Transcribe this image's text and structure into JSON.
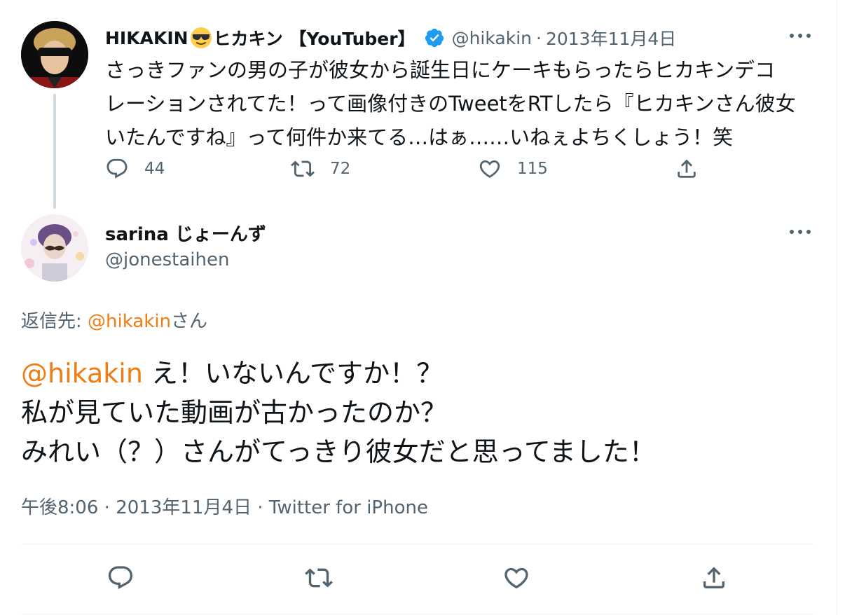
{
  "parent_tweet": {
    "display_name_part1": "HIKAKIN",
    "emoji": "smiling-face-with-sunglasses",
    "display_name_part2": "ヒカキン 【YouTuber】",
    "verified": true,
    "handle": "@hikakin",
    "separator": "·",
    "date": "2013年11月4日",
    "text_lines": [
      "さっきファンの男の子が彼女から誕生日にケーキもらったらヒカキンデコ",
      "レーションされてた！って画像付きのTweetをRTしたら『ヒカキンさん彼女",
      "いたんですね』って何件か来てる…はぁ……いねぇよちくしょう！笑"
    ],
    "actions": {
      "reply_count": "44",
      "retweet_count": "72",
      "like_count": "115"
    }
  },
  "reply_tweet": {
    "display_name": "sarina じょーんず",
    "handle": "@jonestaihen",
    "replying_label": "返信先: ",
    "replying_handle": "@hikakin",
    "replying_suffix": "さん",
    "mention": "@hikakin",
    "text_line1_rest": " え！いないんですか！？",
    "text_line2": "私が見ていた動画が古かったのか？",
    "text_line3": "みれい（？）さんがてっきり彼女だと思ってました！",
    "time": "午後8:06",
    "separator": "·",
    "date": "2013年11月4日",
    "source": "Twitter for iPhone"
  },
  "icons": {
    "more": "more-horizontal-icon",
    "reply": "reply-icon",
    "retweet": "retweet-icon",
    "like": "heart-icon",
    "share": "share-icon",
    "verified": "verified-badge-icon"
  },
  "colors": {
    "text": "#0f1419",
    "secondary": "#536471",
    "accent": "#f07c12",
    "verified": "#1d9bf0",
    "border": "#eff3f4"
  }
}
